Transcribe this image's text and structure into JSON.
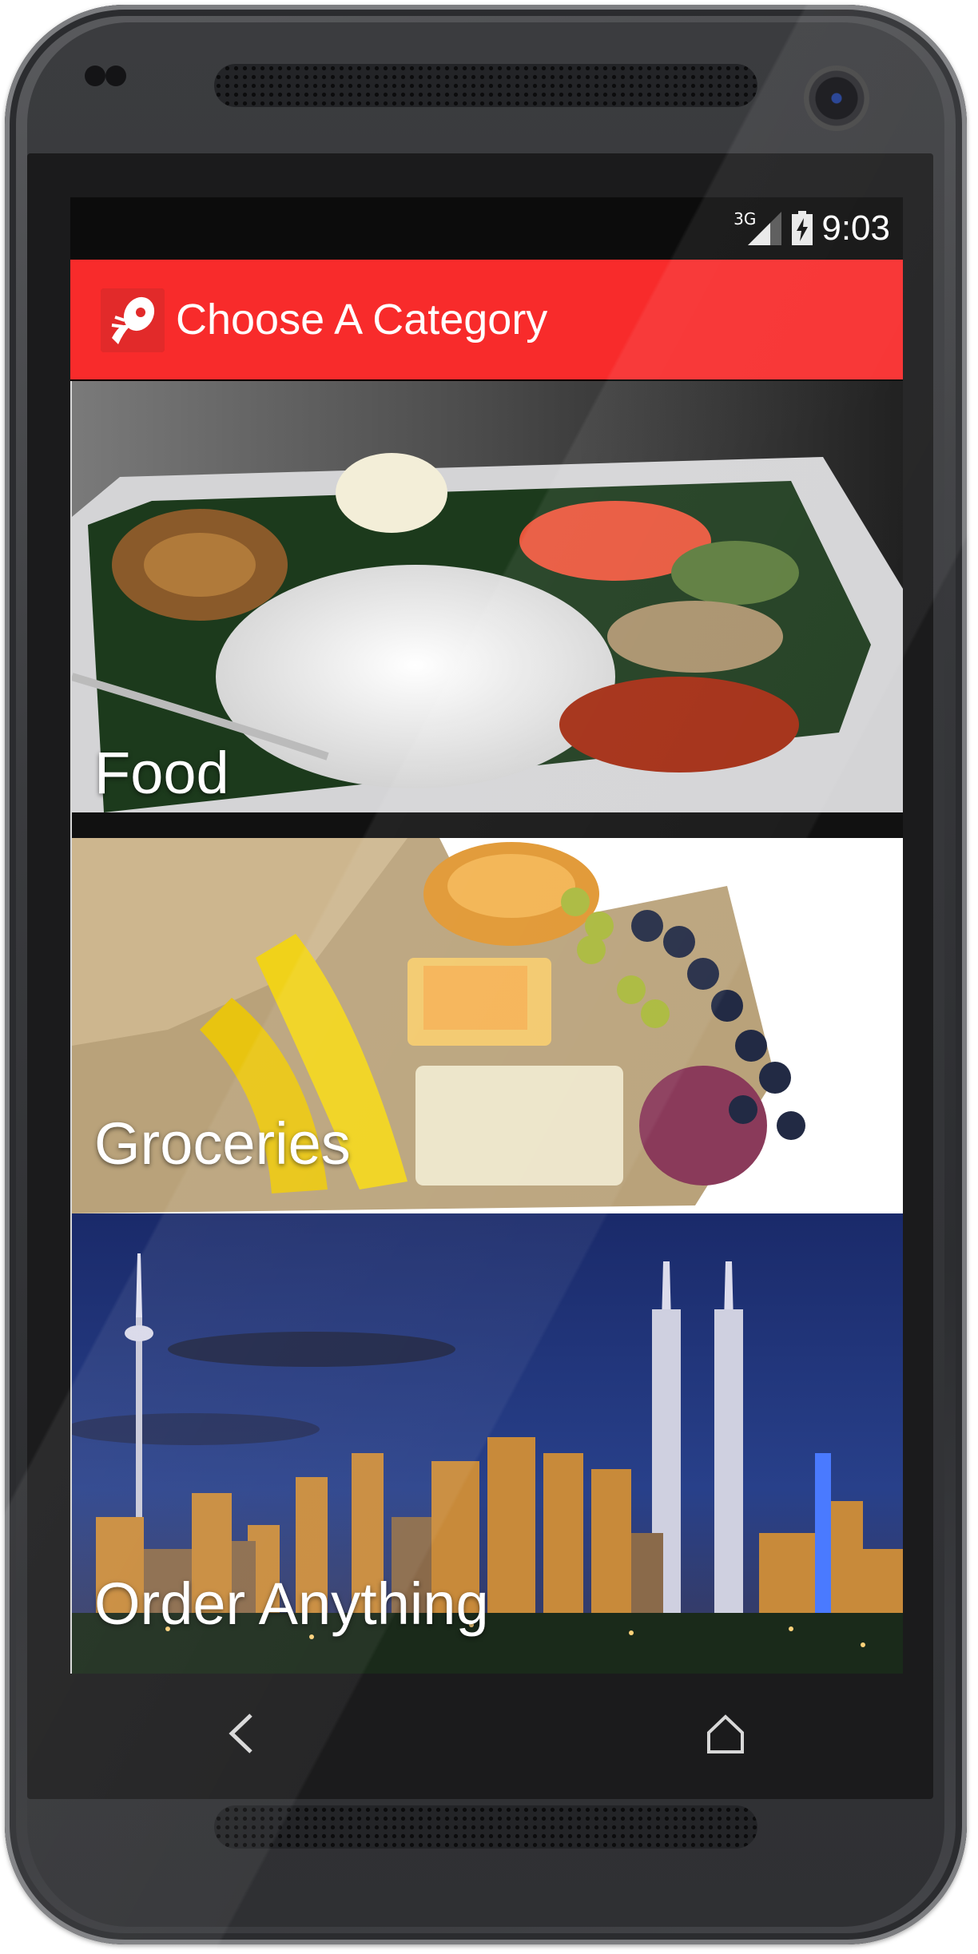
{
  "status_bar": {
    "network_type": "3G",
    "time": "9:03",
    "signal_icon": "cell-signal-icon",
    "battery_icon": "battery-charging-icon"
  },
  "app_bar": {
    "title": "Choose A Category",
    "logo_icon": "app-logo-icon",
    "background_color": "#f82b2b"
  },
  "categories": [
    {
      "label": "Food",
      "image": "plated-rice-meal"
    },
    {
      "label": "Groceries",
      "image": "grocery-bag-produce"
    },
    {
      "label": "Order Anything",
      "image": "city-skyline-night"
    }
  ],
  "nav_bar": {
    "back_icon": "back-chevron-icon",
    "home_icon": "home-icon"
  }
}
